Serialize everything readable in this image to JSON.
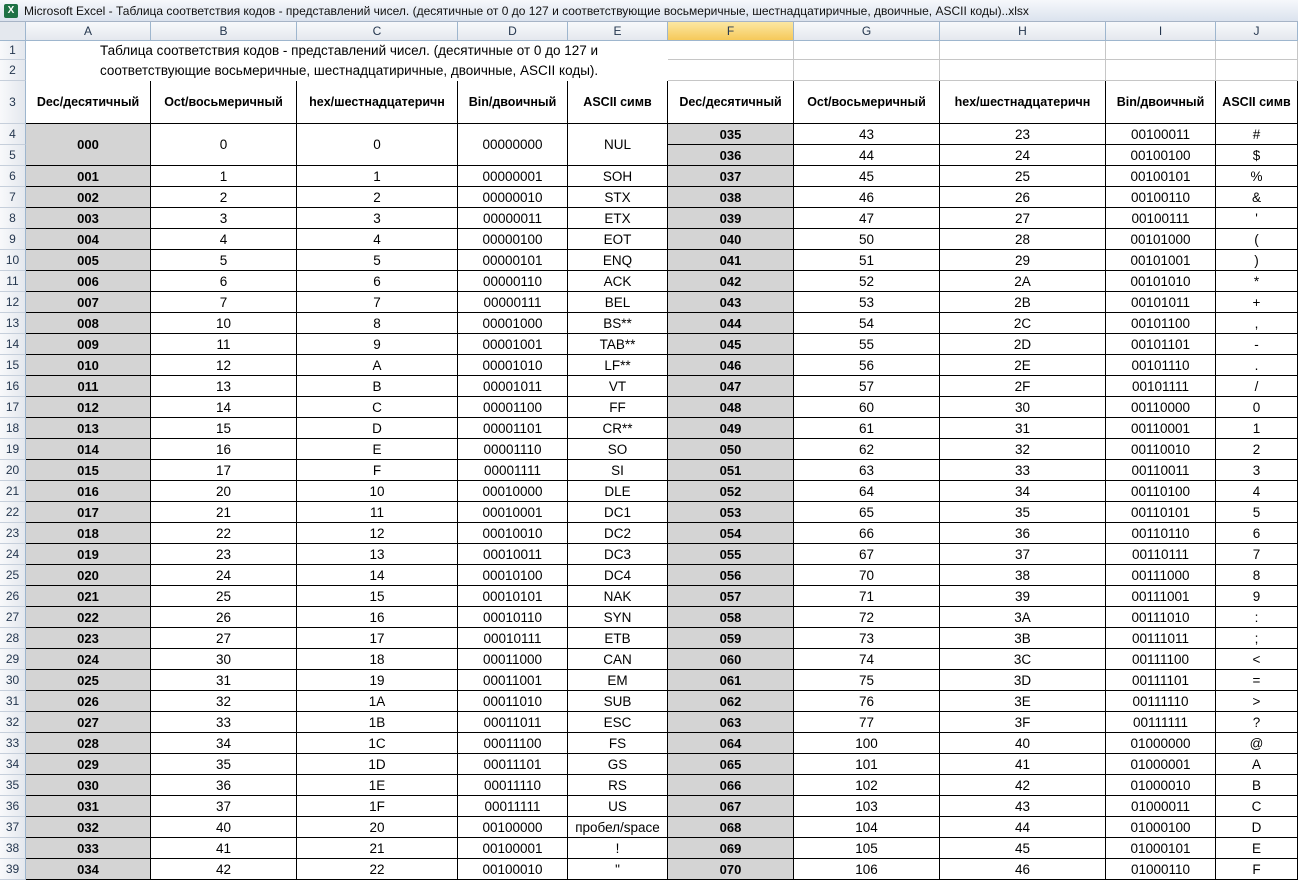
{
  "window": {
    "title": "Microsoft Excel - Таблица соответствия кодов - представлений чисел. (десятичные от 0 до 127 и соответствующие восьмеричные, шестнадцатиричные, двоичные, ASCII коды)..xlsx"
  },
  "sheet": {
    "columns": [
      "A",
      "B",
      "C",
      "D",
      "E",
      "F",
      "G",
      "H",
      "I",
      "J"
    ],
    "row_numbers": [
      "1",
      "2",
      "3",
      "4",
      "5",
      "6",
      "7",
      "8",
      "9",
      "10",
      "11",
      "12",
      "13",
      "14",
      "15",
      "16",
      "17",
      "18",
      "19",
      "20",
      "21",
      "22",
      "23",
      "24",
      "25",
      "26",
      "27",
      "28",
      "29",
      "30",
      "31",
      "32",
      "33",
      "34",
      "35",
      "36",
      "37",
      "38",
      "39"
    ],
    "title_line1": "Таблица соответствия кодов - представлений чисел. (десятичные от 0 до 127 и",
    "title_line2": "соответствующие восьмеричные, шестнадцатиричные, двоичные, ASCII коды).",
    "headers": [
      "Dec/десятичный",
      "Oct/восьмеричный",
      "hex/шестнадцатеричн",
      "Bin/двоичный",
      "ASCII симв"
    ],
    "left_rows": [
      [
        "000",
        "0",
        "0",
        "00000000",
        "NUL"
      ],
      [
        "001",
        "1",
        "1",
        "00000001",
        "SOH"
      ],
      [
        "002",
        "2",
        "2",
        "00000010",
        "STX"
      ],
      [
        "003",
        "3",
        "3",
        "00000011",
        "ETX"
      ],
      [
        "004",
        "4",
        "4",
        "00000100",
        "EOT"
      ],
      [
        "005",
        "5",
        "5",
        "00000101",
        "ENQ"
      ],
      [
        "006",
        "6",
        "6",
        "00000110",
        "ACK"
      ],
      [
        "007",
        "7",
        "7",
        "00000111",
        "BEL"
      ],
      [
        "008",
        "10",
        "8",
        "00001000",
        "BS**"
      ],
      [
        "009",
        "11",
        "9",
        "00001001",
        "TAB**"
      ],
      [
        "010",
        "12",
        "A",
        "00001010",
        "LF**"
      ],
      [
        "011",
        "13",
        "B",
        "00001011",
        "VT"
      ],
      [
        "012",
        "14",
        "C",
        "00001100",
        "FF"
      ],
      [
        "013",
        "15",
        "D",
        "00001101",
        "CR**"
      ],
      [
        "014",
        "16",
        "E",
        "00001110",
        "SO"
      ],
      [
        "015",
        "17",
        "F",
        "00001111",
        "SI"
      ],
      [
        "016",
        "20",
        "10",
        "00010000",
        "DLE"
      ],
      [
        "017",
        "21",
        "11",
        "00010001",
        "DC1"
      ],
      [
        "018",
        "22",
        "12",
        "00010010",
        "DC2"
      ],
      [
        "019",
        "23",
        "13",
        "00010011",
        "DC3"
      ],
      [
        "020",
        "24",
        "14",
        "00010100",
        "DC4"
      ],
      [
        "021",
        "25",
        "15",
        "00010101",
        "NAK"
      ],
      [
        "022",
        "26",
        "16",
        "00010110",
        "SYN"
      ],
      [
        "023",
        "27",
        "17",
        "00010111",
        "ETB"
      ],
      [
        "024",
        "30",
        "18",
        "00011000",
        "CAN"
      ],
      [
        "025",
        "31",
        "19",
        "00011001",
        "EM"
      ],
      [
        "026",
        "32",
        "1A",
        "00011010",
        "SUB"
      ],
      [
        "027",
        "33",
        "1B",
        "00011011",
        "ESC"
      ],
      [
        "028",
        "34",
        "1C",
        "00011100",
        "FS"
      ],
      [
        "029",
        "35",
        "1D",
        "00011101",
        "GS"
      ],
      [
        "030",
        "36",
        "1E",
        "00011110",
        "RS"
      ],
      [
        "031",
        "37",
        "1F",
        "00011111",
        "US"
      ],
      [
        "032",
        "40",
        "20",
        "00100000",
        "пробел/space"
      ],
      [
        "033",
        "41",
        "21",
        "00100001",
        "!"
      ],
      [
        "034",
        "42",
        "22",
        "00100010",
        "\""
      ]
    ],
    "right_rows": [
      [
        "035",
        "43",
        "23",
        "00100011",
        "#"
      ],
      [
        "036",
        "44",
        "24",
        "00100100",
        "$"
      ],
      [
        "037",
        "45",
        "25",
        "00100101",
        "%"
      ],
      [
        "038",
        "46",
        "26",
        "00100110",
        "&"
      ],
      [
        "039",
        "47",
        "27",
        "00100111",
        "'"
      ],
      [
        "040",
        "50",
        "28",
        "00101000",
        "("
      ],
      [
        "041",
        "51",
        "29",
        "00101001",
        ")"
      ],
      [
        "042",
        "52",
        "2A",
        "00101010",
        "*"
      ],
      [
        "043",
        "53",
        "2B",
        "00101011",
        "+"
      ],
      [
        "044",
        "54",
        "2C",
        "00101100",
        ","
      ],
      [
        "045",
        "55",
        "2D",
        "00101101",
        "-"
      ],
      [
        "046",
        "56",
        "2E",
        "00101110",
        "."
      ],
      [
        "047",
        "57",
        "2F",
        "00101111",
        "/"
      ],
      [
        "048",
        "60",
        "30",
        "00110000",
        "0"
      ],
      [
        "049",
        "61",
        "31",
        "00110001",
        "1"
      ],
      [
        "050",
        "62",
        "32",
        "00110010",
        "2"
      ],
      [
        "051",
        "63",
        "33",
        "00110011",
        "3"
      ],
      [
        "052",
        "64",
        "34",
        "00110100",
        "4"
      ],
      [
        "053",
        "65",
        "35",
        "00110101",
        "5"
      ],
      [
        "054",
        "66",
        "36",
        "00110110",
        "6"
      ],
      [
        "055",
        "67",
        "37",
        "00110111",
        "7"
      ],
      [
        "056",
        "70",
        "38",
        "00111000",
        "8"
      ],
      [
        "057",
        "71",
        "39",
        "00111001",
        "9"
      ],
      [
        "058",
        "72",
        "3A",
        "00111010",
        ":"
      ],
      [
        "059",
        "73",
        "3B",
        "00111011",
        ";"
      ],
      [
        "060",
        "74",
        "3C",
        "00111100",
        "<"
      ],
      [
        "061",
        "75",
        "3D",
        "00111101",
        "="
      ],
      [
        "062",
        "76",
        "3E",
        "00111110",
        ">"
      ],
      [
        "063",
        "77",
        "3F",
        "00111111",
        "?"
      ],
      [
        "064",
        "100",
        "40",
        "01000000",
        "@"
      ],
      [
        "065",
        "101",
        "41",
        "01000001",
        "A"
      ],
      [
        "066",
        "102",
        "42",
        "01000010",
        "B"
      ],
      [
        "067",
        "103",
        "43",
        "01000011",
        "C"
      ],
      [
        "068",
        "104",
        "44",
        "01000100",
        "D"
      ],
      [
        "069",
        "105",
        "45",
        "01000101",
        "E"
      ],
      [
        "070",
        "106",
        "46",
        "01000110",
        "F"
      ]
    ]
  }
}
